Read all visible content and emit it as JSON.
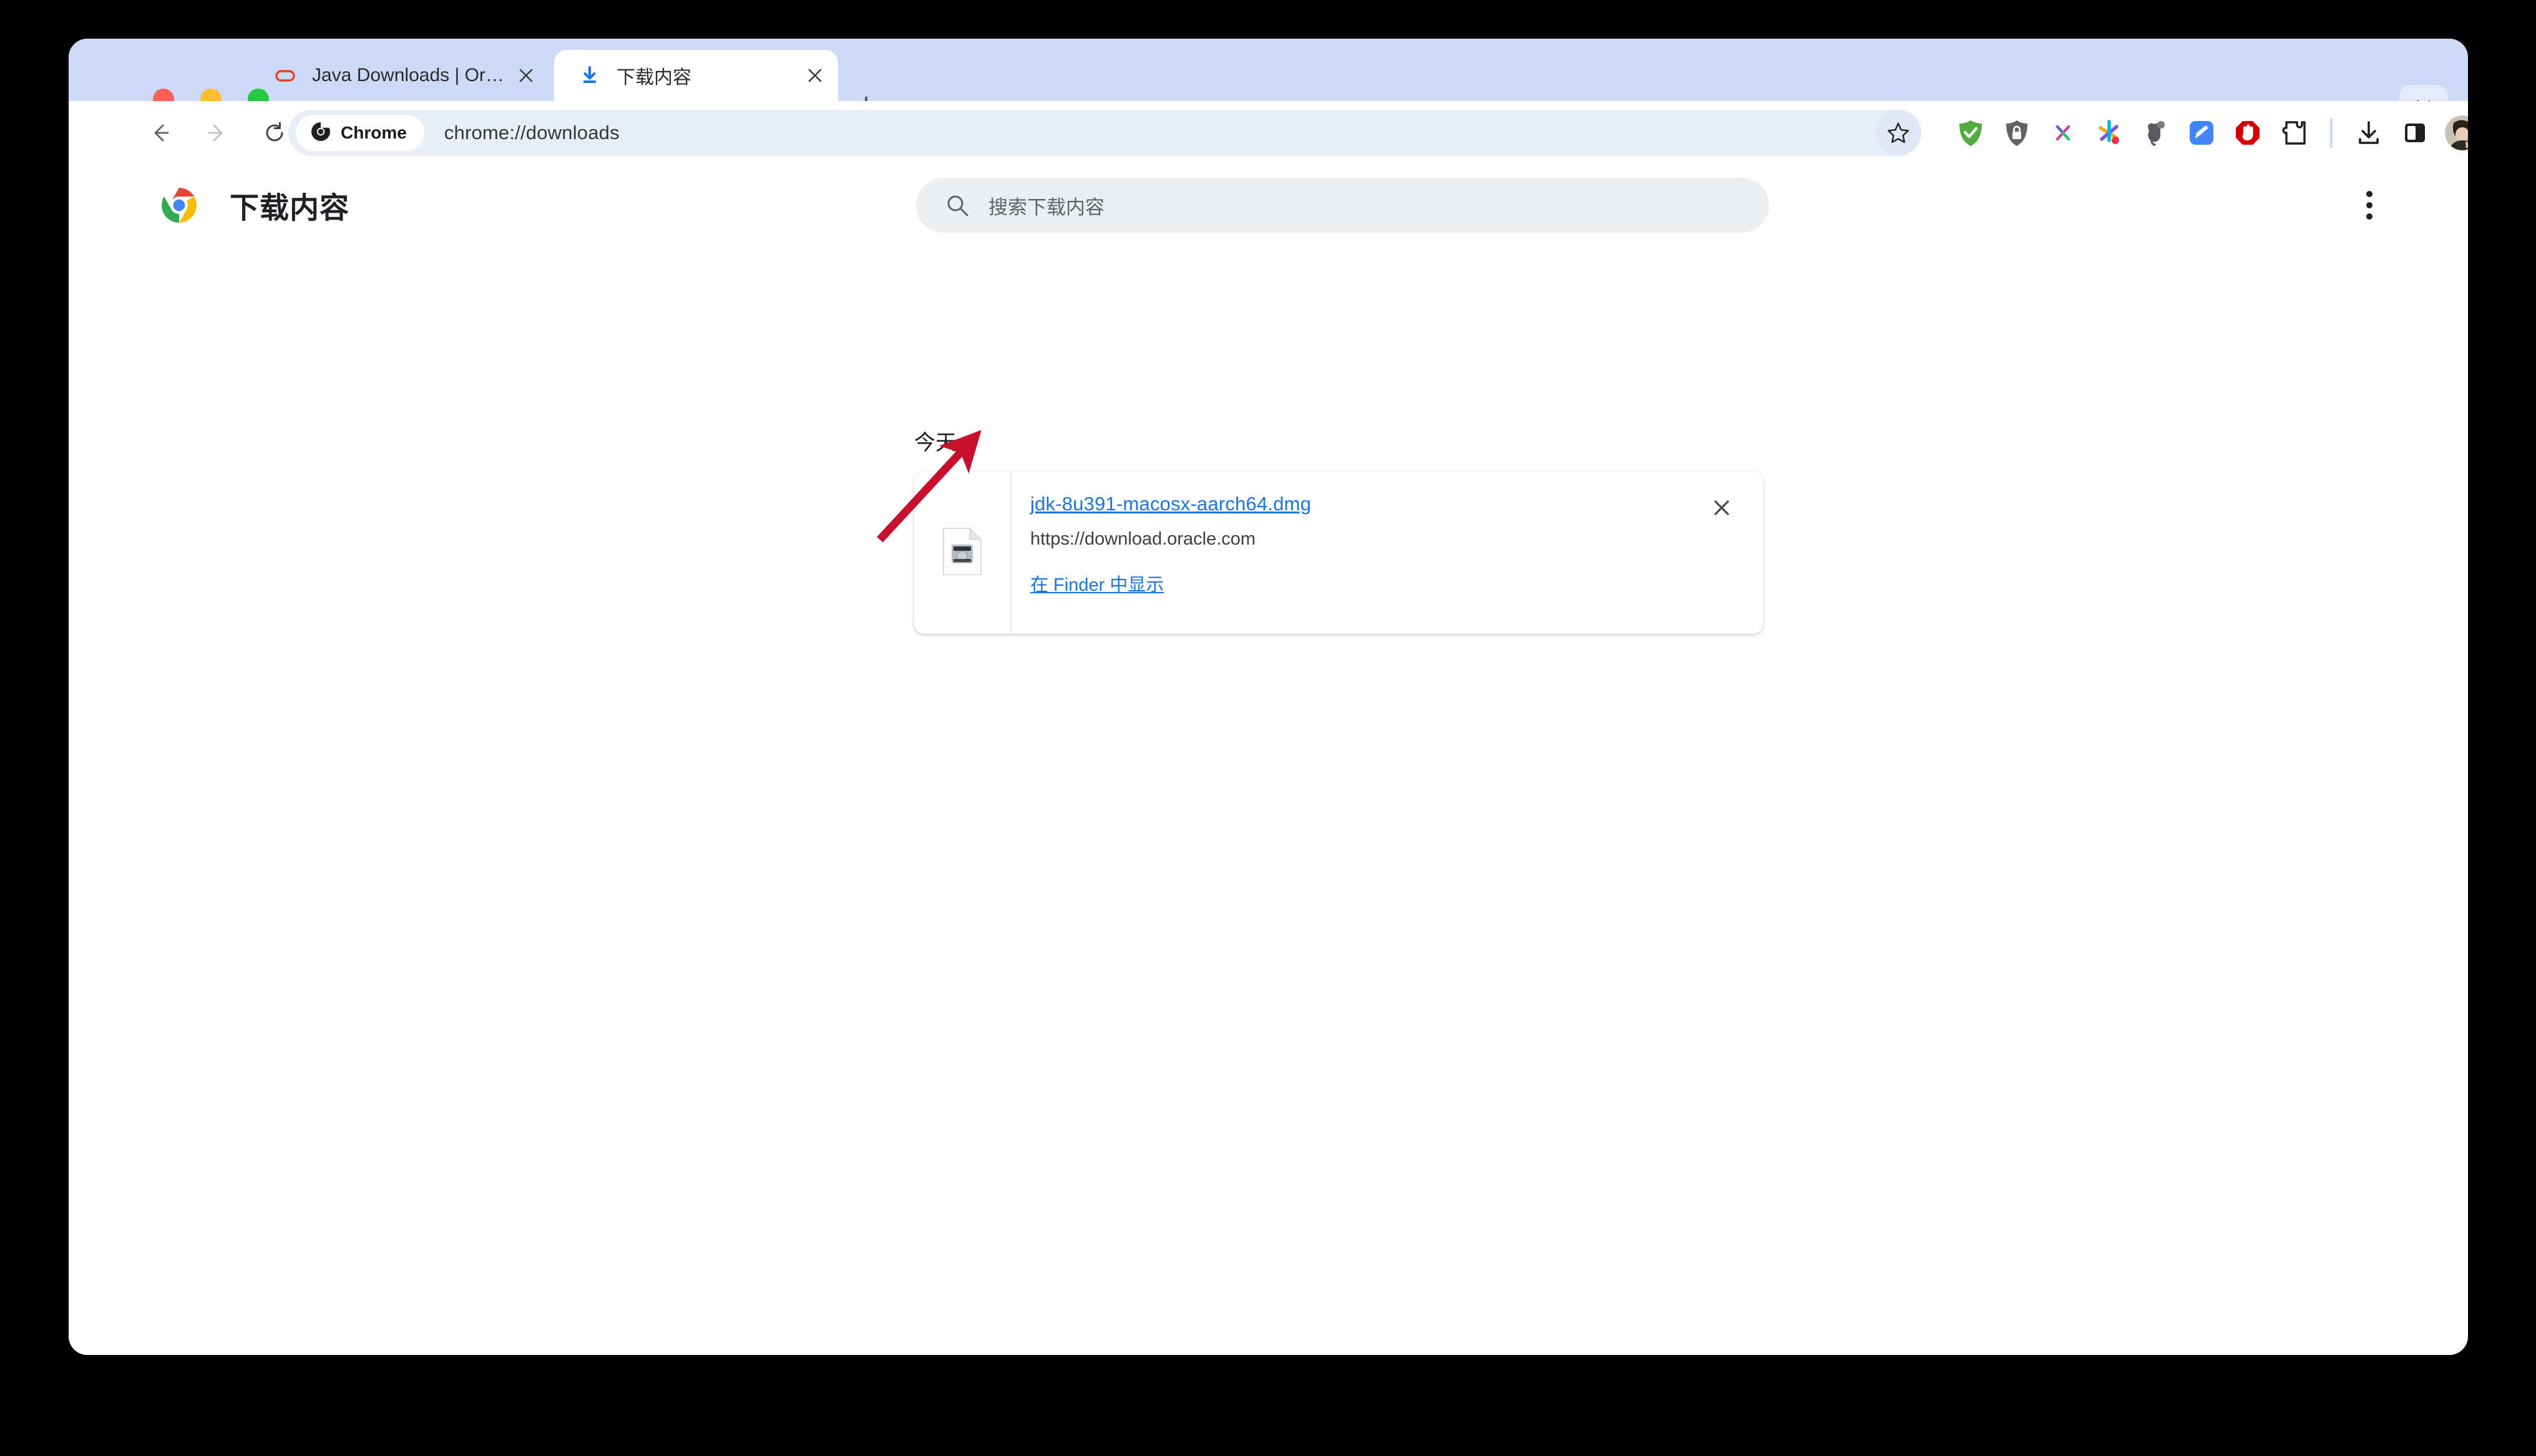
{
  "window": {
    "traffic_lights": [
      {
        "name": "close",
        "color": "#ff5f57"
      },
      {
        "name": "minimize",
        "color": "#febc2e"
      },
      {
        "name": "maximize",
        "color": "#28c840"
      }
    ]
  },
  "tabstrip": {
    "background": "#ccd9f7",
    "tabs": [
      {
        "title": "Java Downloads | Oracle",
        "favicon": "oracle-favicon",
        "active": false
      },
      {
        "title": "下载内容",
        "favicon": "download-favicon",
        "active": true
      }
    ],
    "new_tab_label": "+",
    "tab_search_icon": "chevron-down-icon"
  },
  "toolbar": {
    "back_icon": "back-arrow-icon",
    "forward_icon": "forward-arrow-icon",
    "reload_icon": "reload-icon",
    "chip_label": "Chrome",
    "url": "chrome://downloads",
    "bookmark_icon": "star-icon",
    "extensions": [
      {
        "name": "adguard-shield-icon",
        "color": "#53aa3e"
      },
      {
        "name": "privacy-lock-shield-icon",
        "color": "#5f6368"
      },
      {
        "name": "x-letter-icon",
        "color": "#7b4ff0"
      },
      {
        "name": "asterisk-icon",
        "color": "#e8336d"
      },
      {
        "name": "evernote-elephant-icon",
        "color": "#595b60"
      },
      {
        "name": "pencil-note-icon",
        "color": "#4285f4"
      },
      {
        "name": "adblock-stop-hand-icon",
        "color": "#d60000"
      },
      {
        "name": "puzzle-extensions-icon",
        "color": "#1f1f1f"
      },
      {
        "name": "downloads-icon",
        "color": "#1f1f1f"
      },
      {
        "name": "side-panel-icon",
        "color": "#1f1f1f"
      }
    ],
    "avatar_name": "profile-avatar",
    "menu_icon": "three-dot-menu-icon"
  },
  "page": {
    "chrome_logo": "chrome-logo-icon",
    "title": "下载内容",
    "search": {
      "icon": "search-icon",
      "placeholder": "搜索下载内容",
      "value": ""
    },
    "more_menu_icon": "three-dot-menu-icon",
    "date_group": "今天",
    "downloads": [
      {
        "file_icon": "dmg-disk-image-icon",
        "file_name": "jdk-8u391-macosx-aarch64.dmg",
        "source_url": "https://download.oracle.com",
        "action_label": "在 Finder 中显示",
        "remove_icon": "close-icon"
      }
    ]
  },
  "annotation": {
    "type": "arrow",
    "color": "#c8102e",
    "points_to": "在 Finder 中显示"
  }
}
